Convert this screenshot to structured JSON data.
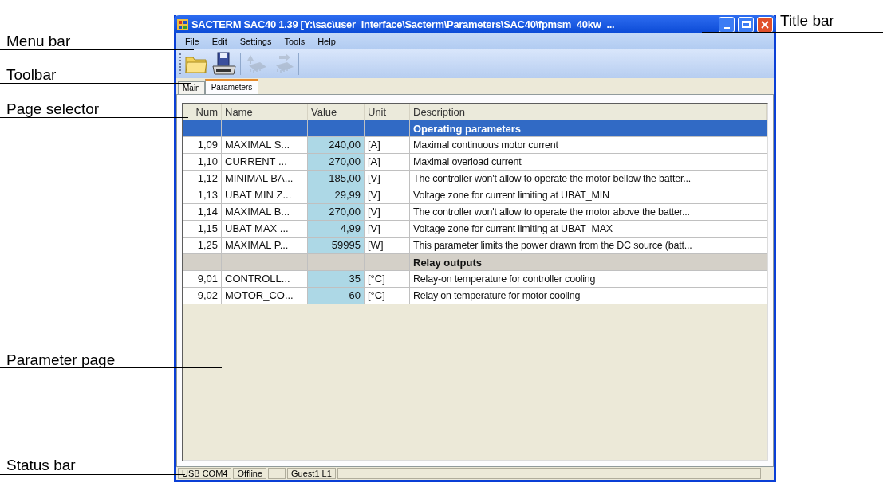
{
  "annotations": [
    {
      "kind": "right",
      "label": "Title bar"
    },
    {
      "kind": "left",
      "label": "Menu bar"
    },
    {
      "kind": "left",
      "label": "Toolbar"
    },
    {
      "kind": "left",
      "label": "Page selector"
    },
    {
      "kind": "left",
      "label": "Parameter page"
    },
    {
      "kind": "left",
      "label": "Status bar"
    }
  ],
  "window": {
    "title": "SACTERM SAC40 1.39 [Y:\\sac\\user_interface\\Sacterm\\Parameters\\SAC40\\fpmsm_40kw_..."
  },
  "menu": [
    "File",
    "Edit",
    "Settings",
    "Tools",
    "Help"
  ],
  "toolbar": [
    {
      "kind": "open",
      "disabled": false
    },
    {
      "kind": "save",
      "disabled": false
    },
    {
      "kind": "read",
      "disabled": true
    },
    {
      "kind": "write",
      "disabled": true
    }
  ],
  "tabs": [
    {
      "label": "Main",
      "selected": false
    },
    {
      "label": "Parameters",
      "selected": true
    }
  ],
  "table": {
    "columns": [
      "Num",
      "Name",
      "Value",
      "Unit",
      "Description"
    ],
    "rows": [
      {
        "kind": "group",
        "title": "Operating parameters",
        "selected": true
      },
      {
        "kind": "param",
        "num": "1,09",
        "name": "MAXIMAL S...",
        "value": "240,00",
        "unit": "[A]",
        "description": "Maximal continuous motor current"
      },
      {
        "kind": "param",
        "num": "1,10",
        "name": "CURRENT ...",
        "value": "270,00",
        "unit": "[A]",
        "description": "Maximal overload current"
      },
      {
        "kind": "param",
        "num": "1,12",
        "name": "MINIMAL BA...",
        "value": "185,00",
        "unit": "[V]",
        "description": "The controller won't allow to operate the motor bellow the batter..."
      },
      {
        "kind": "param",
        "num": "1,13",
        "name": "UBAT MIN Z...",
        "value": "29,99",
        "unit": "[V]",
        "description": "Voltage zone for current limiting at UBAT_MIN"
      },
      {
        "kind": "param",
        "num": "1,14",
        "name": "MAXIMAL B...",
        "value": "270,00",
        "unit": "[V]",
        "description": "The controller won't allow to operate the motor above the batter..."
      },
      {
        "kind": "param",
        "num": "1,15",
        "name": "UBAT MAX ...",
        "value": "4,99",
        "unit": "[V]",
        "description": "Voltage zone for current limiting at UBAT_MAX"
      },
      {
        "kind": "param",
        "num": "1,25",
        "name": "MAXIMAL P...",
        "value": "59995",
        "unit": "[W]",
        "description": "This parameter limits the power drawn from the DC source (batt..."
      },
      {
        "kind": "group",
        "title": "Relay outputs",
        "selected": false
      },
      {
        "kind": "param",
        "num": "9,01",
        "name": "CONTROLL...",
        "value": "35",
        "unit": "[°C]",
        "description": "Relay-on temperature for controller cooling"
      },
      {
        "kind": "param",
        "num": "9,02",
        "name": "MOTOR_CO...",
        "value": "60",
        "unit": "[°C]",
        "description": "Relay on temperature for motor cooling"
      }
    ]
  },
  "status_bar": [
    {
      "kind": "text",
      "text": "USB COM4"
    },
    {
      "kind": "text",
      "text": "Offline"
    },
    {
      "kind": "blank"
    },
    {
      "kind": "text",
      "text": "Guest1 L1"
    },
    {
      "kind": "filler"
    }
  ]
}
